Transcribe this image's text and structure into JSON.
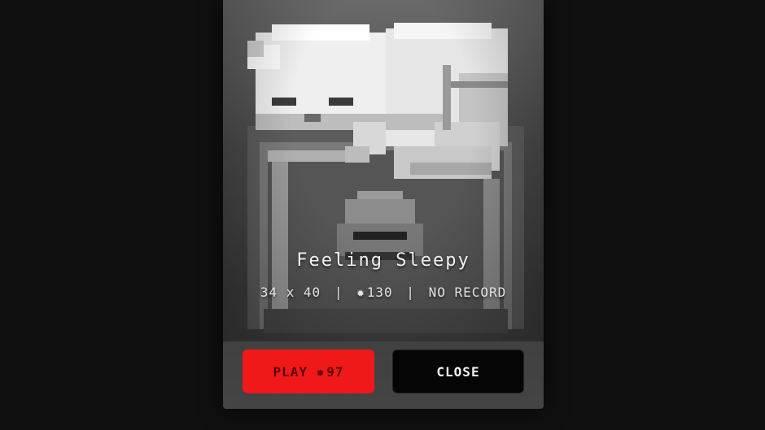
{
  "puzzle": {
    "title": "Feeling Sleepy",
    "width": "34",
    "height": "40",
    "size_separator": "x",
    "coin_cost": "130",
    "record": "NO RECORD",
    "separator": "|"
  },
  "icons": {
    "coin": "gear-icon"
  },
  "buttons": {
    "play_label": "PLAY",
    "play_cost": "97",
    "close_label": "CLOSE"
  },
  "colors": {
    "play_bg": "#f01818",
    "play_text": "#5a0000",
    "close_bg": "#050505",
    "close_text": "#f4f4f4",
    "backdrop": "#101010"
  }
}
